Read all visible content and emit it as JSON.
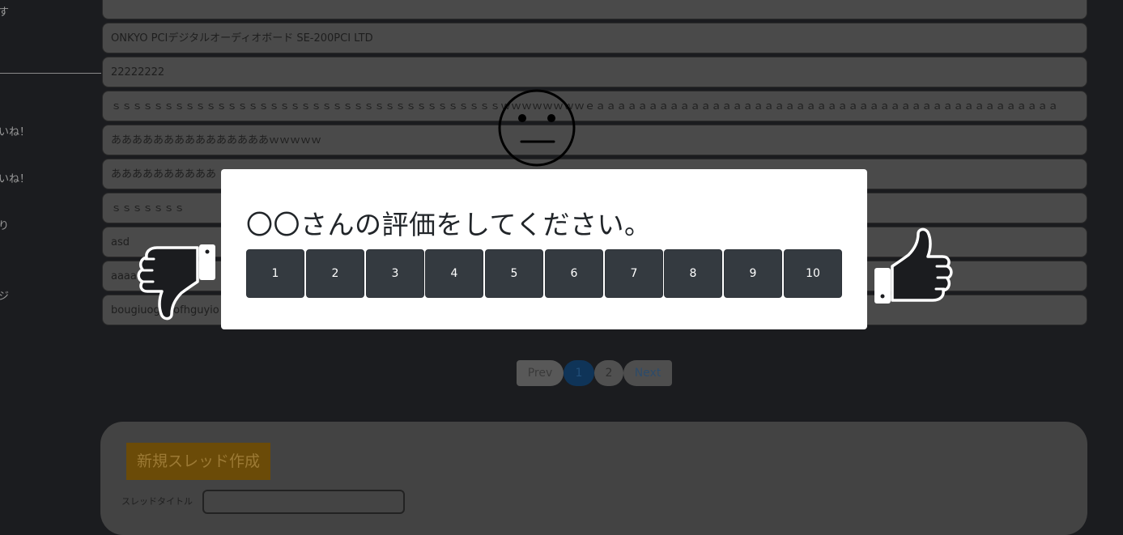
{
  "sidebar": {
    "items": [
      "す",
      "いね！",
      "いね！",
      "り",
      "ジ"
    ]
  },
  "threads": [
    "",
    "ONKYO PCIデジタルオーディオボード SE-200PCI LTD",
    "22222222",
    "ｓｓｓｓｓｓｓｓｓｓｓｓｓｓｓｓｓｓｓｓｓｓｓｓｓｓｓｓｓｓｓｓｓｓｓｓｓｗｗｗｗｗｗｗｗｅａａａａａａａａａａａａａａａａａａａａａａａａａａａａａａａａａａａａａａａａａａａａ",
    "あああああああああああああああｗｗｗｗｗ",
    "ああああああああああ",
    "ｓｓｓｓｓｓｓ",
    "asd",
    "aaaaaaaa",
    "bougiuogfuiofhguyio"
  ],
  "pagination": {
    "prev": "Prev",
    "pages": [
      "1",
      "2"
    ],
    "next": "Next",
    "active_page": "1"
  },
  "new_thread": {
    "button_label": "新規スレッド作成",
    "title_label": "スレッドタイトル"
  },
  "modal": {
    "title": "〇〇さんの評価をしてください。",
    "ratings": [
      "1",
      "2",
      "3",
      "4",
      "5",
      "6",
      "7",
      "8",
      "9",
      "10"
    ]
  },
  "icons": {
    "face": "neutral-face-icon",
    "left": "thumbs-down-icon",
    "right": "thumbs-up-icon"
  },
  "colors": {
    "background": "#1b1c1f",
    "rating_button": "#343a40",
    "modal_bg": "#ffffff",
    "new_thread_button": "#6b4b08",
    "active_page": "#0f3458"
  }
}
